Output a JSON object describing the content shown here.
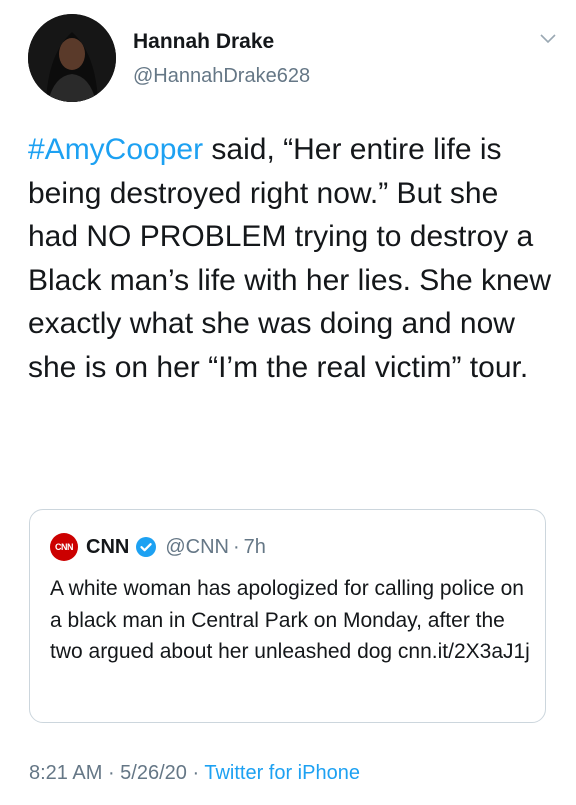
{
  "author": {
    "name": "Hannah Drake",
    "handle": "@HannahDrake628"
  },
  "tweet": {
    "hashtag": "#AmyCooper",
    "text": " said, “Her entire life is being destroyed right now.” But she had NO PROBLEM trying to destroy a Black man’s life with her lies. She knew exactly what she was doing and now she is on her “I’m the real victim” tour."
  },
  "quoted_tweet": {
    "logo_text": "CNN",
    "name": "CNN",
    "handle": "@CNN",
    "separator": "·",
    "time": "7h",
    "text": "A white woman has apologized for calling police on a black man in Central Park on Monday, after the two argued about her unleashed dog cnn.it/2X3aJ1j"
  },
  "meta": {
    "time": "8:21 AM",
    "separator": " · ",
    "date": "5/26/20",
    "separator2": " · ",
    "source": "Twitter for iPhone"
  },
  "colors": {
    "link": "#1da1f2",
    "secondary": "#657786",
    "border": "#ccd6dd"
  },
  "icons": [
    "chevron-down-icon",
    "verified-badge-icon",
    "cnn-logo"
  ]
}
